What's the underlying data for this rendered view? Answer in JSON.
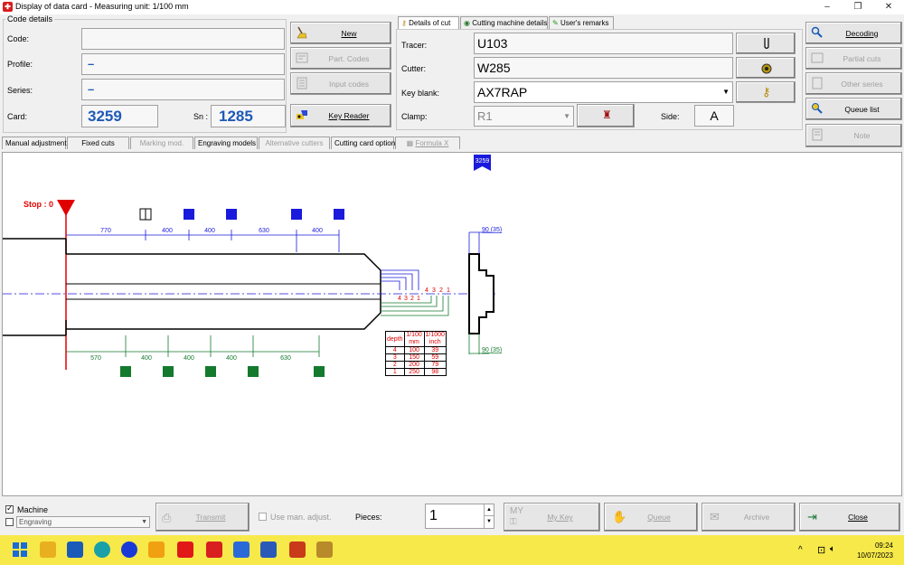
{
  "window": {
    "title": "Display of data card - Measuring unit: 1/100 mm",
    "min": "–",
    "max": "❐",
    "close": "✕"
  },
  "code_details": {
    "legend": "Code details",
    "code_label": "Code:",
    "code_value": "",
    "profile_label": "Profile:",
    "profile_value": "–",
    "series_label": "Series:",
    "series_value": "–",
    "card_label": "Card:",
    "card_value": "3259",
    "sn_label": "Sn :",
    "sn_value": "1285"
  },
  "left_buttons": {
    "new": "New",
    "part_codes": "Part. Codes",
    "input_codes": "Input codes",
    "key_reader": "Key Reader"
  },
  "tabs_top": {
    "details_of_cut": "Details of cut",
    "cutting_machine": "Cutting machine details",
    "users_remarks": "User's remarks"
  },
  "cut_details": {
    "tracer_label": "Tracer:",
    "tracer_value": "U103",
    "cutter_label": "Cutter:",
    "cutter_value": "W285",
    "key_blank_label": "Key blank:",
    "key_blank_value": "AX7RAP",
    "clamp_label": "Clamp:",
    "clamp_value": "R1",
    "side_label": "Side:",
    "side_value": "A"
  },
  "right_buttons": {
    "decoding": "Decoding",
    "partial_cuts": "Partial cuts",
    "other_series": "Other series",
    "queue_list": "Queue list",
    "note": "Note"
  },
  "mid_tabs": [
    "Manual adjustments",
    "Fixed cuts",
    "Marking mod.",
    "Engraving models",
    "Alternative cutters",
    "Cutting card options",
    "Formula X"
  ],
  "drawing": {
    "card_flag": "3259",
    "stop_label": "Stop : 0",
    "top_dims": [
      "770",
      "400",
      "400",
      "630",
      "400"
    ],
    "bottom_dims": [
      "570",
      "400",
      "400",
      "400",
      "630"
    ],
    "depth_numbers_left": [
      "4",
      "3",
      "2",
      "1"
    ],
    "depth_numbers_right": [
      "4",
      "3",
      "2",
      "1"
    ],
    "right_top_dim": "90 (35)",
    "right_bottom_dim": "90 (35)",
    "table": {
      "headers": [
        "depth",
        "1/100 mm",
        "1/1000 inch"
      ],
      "rows": [
        [
          "4",
          "100",
          "39"
        ],
        [
          "3",
          "150",
          "59"
        ],
        [
          "2",
          "200",
          "79"
        ],
        [
          "1",
          "250",
          "98"
        ]
      ]
    }
  },
  "bottom": {
    "machine_label": "Machine",
    "engraving_value": "Engraving",
    "transmit": "Transmit",
    "use_man_adjust": "Use man. adjust.",
    "pieces_label": "Pieces:",
    "pieces_value": "1",
    "my_key_logo": "MY",
    "my_key": "My Key",
    "queue": "Queue",
    "archive": "Archive",
    "close": "Close"
  },
  "taskbar": {
    "time": "09:24",
    "date": "10/07/2023",
    "tray_caret": "^"
  },
  "colors": {
    "blue": "#1a1adc",
    "green": "#137a2e",
    "red": "#e00000",
    "accent_blue": "#1e5ab8"
  }
}
